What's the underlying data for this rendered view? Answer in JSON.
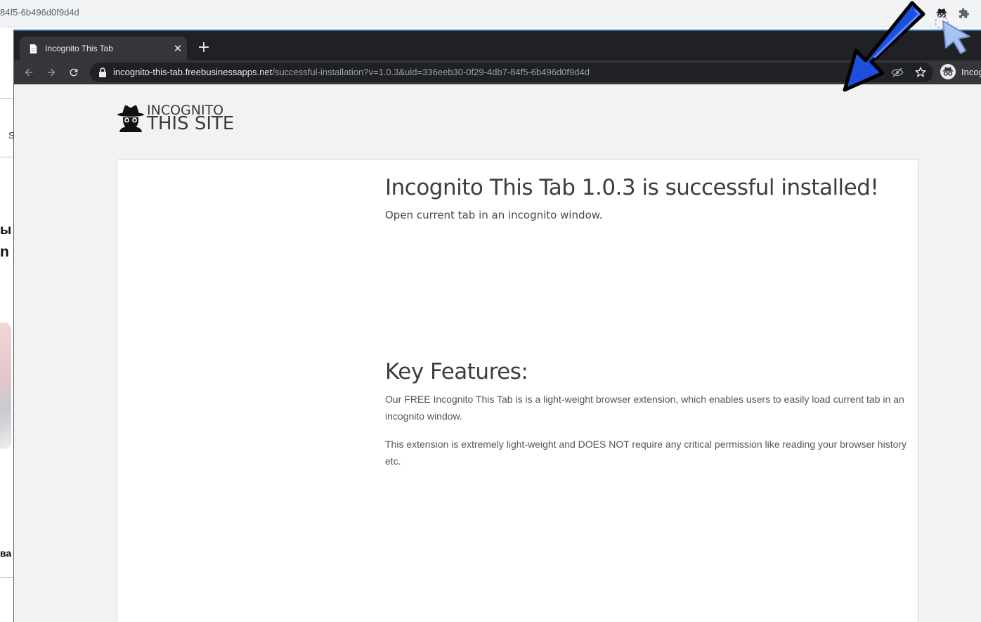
{
  "background_window": {
    "url_fragment": "84f5-6b496d0f9d4d",
    "left_fragments": [
      "S",
      "ы",
      "n /",
      "ва"
    ]
  },
  "window": {
    "tab": {
      "title": "Incognito This Tab",
      "close": "✕"
    },
    "new_tab": "+",
    "address": {
      "host": "incognito-this-tab.freebusinessapps.net",
      "path": "/successful-installation?v=1.0.3&uid=336eeb30-0f29-4db7-84f5-6b496d0f9d4d"
    },
    "profile_label": "Incog"
  },
  "page": {
    "logo": {
      "line1": "INCOGNITO",
      "line2": "THIS SITE"
    },
    "heading": "Incognito This Tab 1.0.3 is successful installed!",
    "subtitle": "Open current tab in an incognito window.",
    "features_heading": "Key Features:",
    "paragraphs": [
      "Our FREE Incognito This Tab is is a light-weight browser extension, which enables users to easily load current tab in an incognito window.",
      "This extension is extremely light-weight and DOES NOT require any critical permission like reading your browser history etc."
    ]
  },
  "colors": {
    "arrow": "#1a4fe0",
    "dark_chrome": "#35363a",
    "tabstrip": "#202124",
    "page_bg": "#f2f2f2"
  },
  "icons": [
    "back-icon",
    "forward-icon",
    "reload-icon",
    "lock-icon",
    "eye-off-icon",
    "star-icon",
    "incognito-icon",
    "extensions-puzzle-icon",
    "cursor-icon",
    "pointing-arrow-icon"
  ]
}
